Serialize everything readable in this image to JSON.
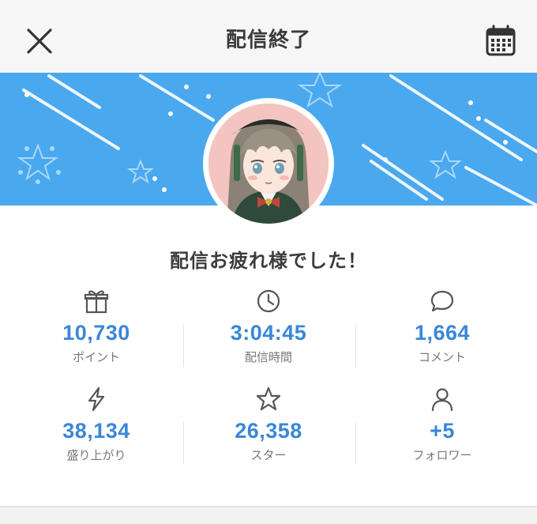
{
  "header": {
    "title": "配信終了",
    "close_icon": "close-icon",
    "calendar_icon": "calendar-icon"
  },
  "colors": {
    "banner": "#4aa8ee",
    "value_text": "#3a87d8",
    "label_text": "#777777"
  },
  "message": "配信お疲れ様でした！",
  "stats": [
    {
      "icon": "gift-icon",
      "value": "10,730",
      "label": "ポイント"
    },
    {
      "icon": "clock-icon",
      "value": "3:04:45",
      "label": "配信時間"
    },
    {
      "icon": "comment-icon",
      "value": "1,664",
      "label": "コメント"
    },
    {
      "icon": "lightning-icon",
      "value": "38,134",
      "label": "盛り上がり"
    },
    {
      "icon": "star-icon",
      "value": "26,358",
      "label": "スター"
    },
    {
      "icon": "person-icon",
      "value": "+5",
      "label": "フォロワー"
    }
  ]
}
